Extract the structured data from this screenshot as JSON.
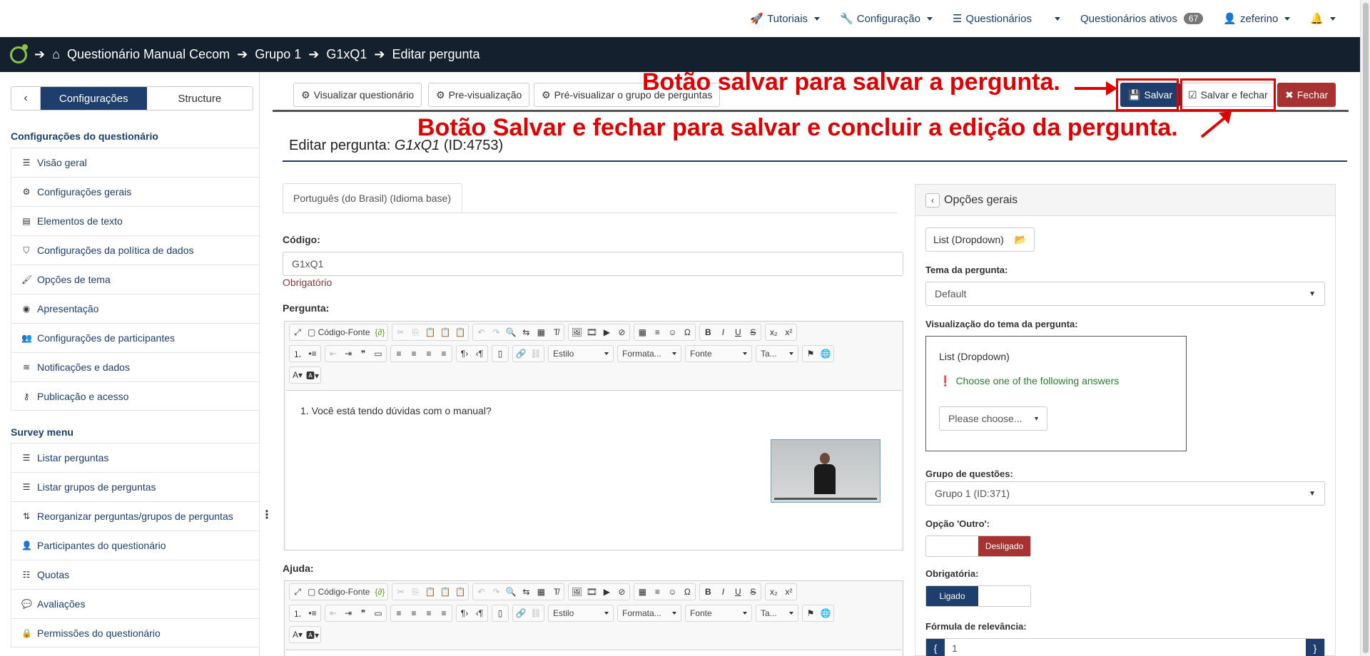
{
  "topnav": {
    "tutorials": "Tutoriais",
    "configuration": "Configuração",
    "surveys": "Questionários",
    "active_surveys": "Questionários ativos",
    "active_count": "67",
    "user": "zeferino"
  },
  "breadcrumb": {
    "survey": "Questionário Manual Cecom",
    "group": "Grupo 1",
    "question": "G1xQ1",
    "current": "Editar pergunta"
  },
  "sidebar": {
    "tab_config": "Configurações",
    "tab_structure": "Structure",
    "heading_config": "Configurações do questionário",
    "config_items": [
      {
        "label": "Visão geral",
        "icon": "list-icon"
      },
      {
        "label": "Configurações gerais",
        "icon": "cogs-icon"
      },
      {
        "label": "Elementos de texto",
        "icon": "file-text-icon"
      },
      {
        "label": "Configurações da política de dados",
        "icon": "shield-icon"
      },
      {
        "label": "Opções de tema",
        "icon": "paint-brush-icon"
      },
      {
        "label": "Apresentação",
        "icon": "eye-slash-icon"
      },
      {
        "label": "Configurações de participantes",
        "icon": "users-icon"
      },
      {
        "label": "Notificações e dados",
        "icon": "rss-icon"
      },
      {
        "label": "Publicação e acesso",
        "icon": "key-icon"
      }
    ],
    "heading_menu": "Survey menu",
    "menu_items": [
      {
        "label": "Listar perguntas",
        "icon": "list-icon"
      },
      {
        "label": "Listar grupos de perguntas",
        "icon": "list-icon"
      },
      {
        "label": "Reorganizar perguntas/grupos de perguntas",
        "icon": "reorder-icon"
      },
      {
        "label": "Participantes do questionário",
        "icon": "user-icon"
      },
      {
        "label": "Quotas",
        "icon": "tasks-icon"
      },
      {
        "label": "Avaliações",
        "icon": "comment-icon"
      },
      {
        "label": "Permissões do questionário",
        "icon": "lock-icon"
      }
    ]
  },
  "toolbar": {
    "view_survey": "Visualizar questionário",
    "preview": "Pre-visualização",
    "preview_group": "Pré-visualizar o grupo de perguntas",
    "save": "Salvar",
    "save_close": "Salvar e fechar",
    "close": "Fechar"
  },
  "annotations": {
    "save": "Botão salvar para salvar a pergunta.",
    "save_close": "Botão Salvar e fechar para salvar e concluir a edição da pergunta."
  },
  "editor_page": {
    "title_prefix": "Editar pergunta:",
    "title_code": "G1xQ1",
    "title_id": "(ID:4753)",
    "language_tab": "Português (do Brasil) (Idioma base)",
    "code_label": "Código:",
    "code_value": "G1xQ1",
    "code_required": "Obrigatório",
    "question_label": "Pergunta:",
    "question_text": "1. Você está tendo dúvidas com o manual?",
    "help_label": "Ajuda:",
    "source_button": "Código-Fonte",
    "combo_style": "Estilo",
    "combo_format": "Formata...",
    "combo_font": "Fonte",
    "combo_size": "Ta..."
  },
  "general_options": {
    "title": "Opções gerais",
    "question_type": "List (Dropdown)",
    "theme_label": "Tema da pergunta:",
    "theme_value": "Default",
    "theme_preview_label": "Visualização do tema da pergunta:",
    "preview_title": "List (Dropdown)",
    "preview_hint": "Choose one of the following answers",
    "preview_select": "Please choose...",
    "group_label": "Grupo de questões:",
    "group_value": "Grupo 1 (ID:371)",
    "other_label": "Opção 'Outro':",
    "other_state": "Desligado",
    "mandatory_label": "Obrigatória:",
    "mandatory_state": "Ligado",
    "relevance_label": "Fórmula de relevância:",
    "relevance_value": "1"
  },
  "colors": {
    "primary": "#1e3f6e",
    "danger": "#a83232",
    "annotation": "#e00000",
    "breadcrumb_bg": "#14202d"
  }
}
